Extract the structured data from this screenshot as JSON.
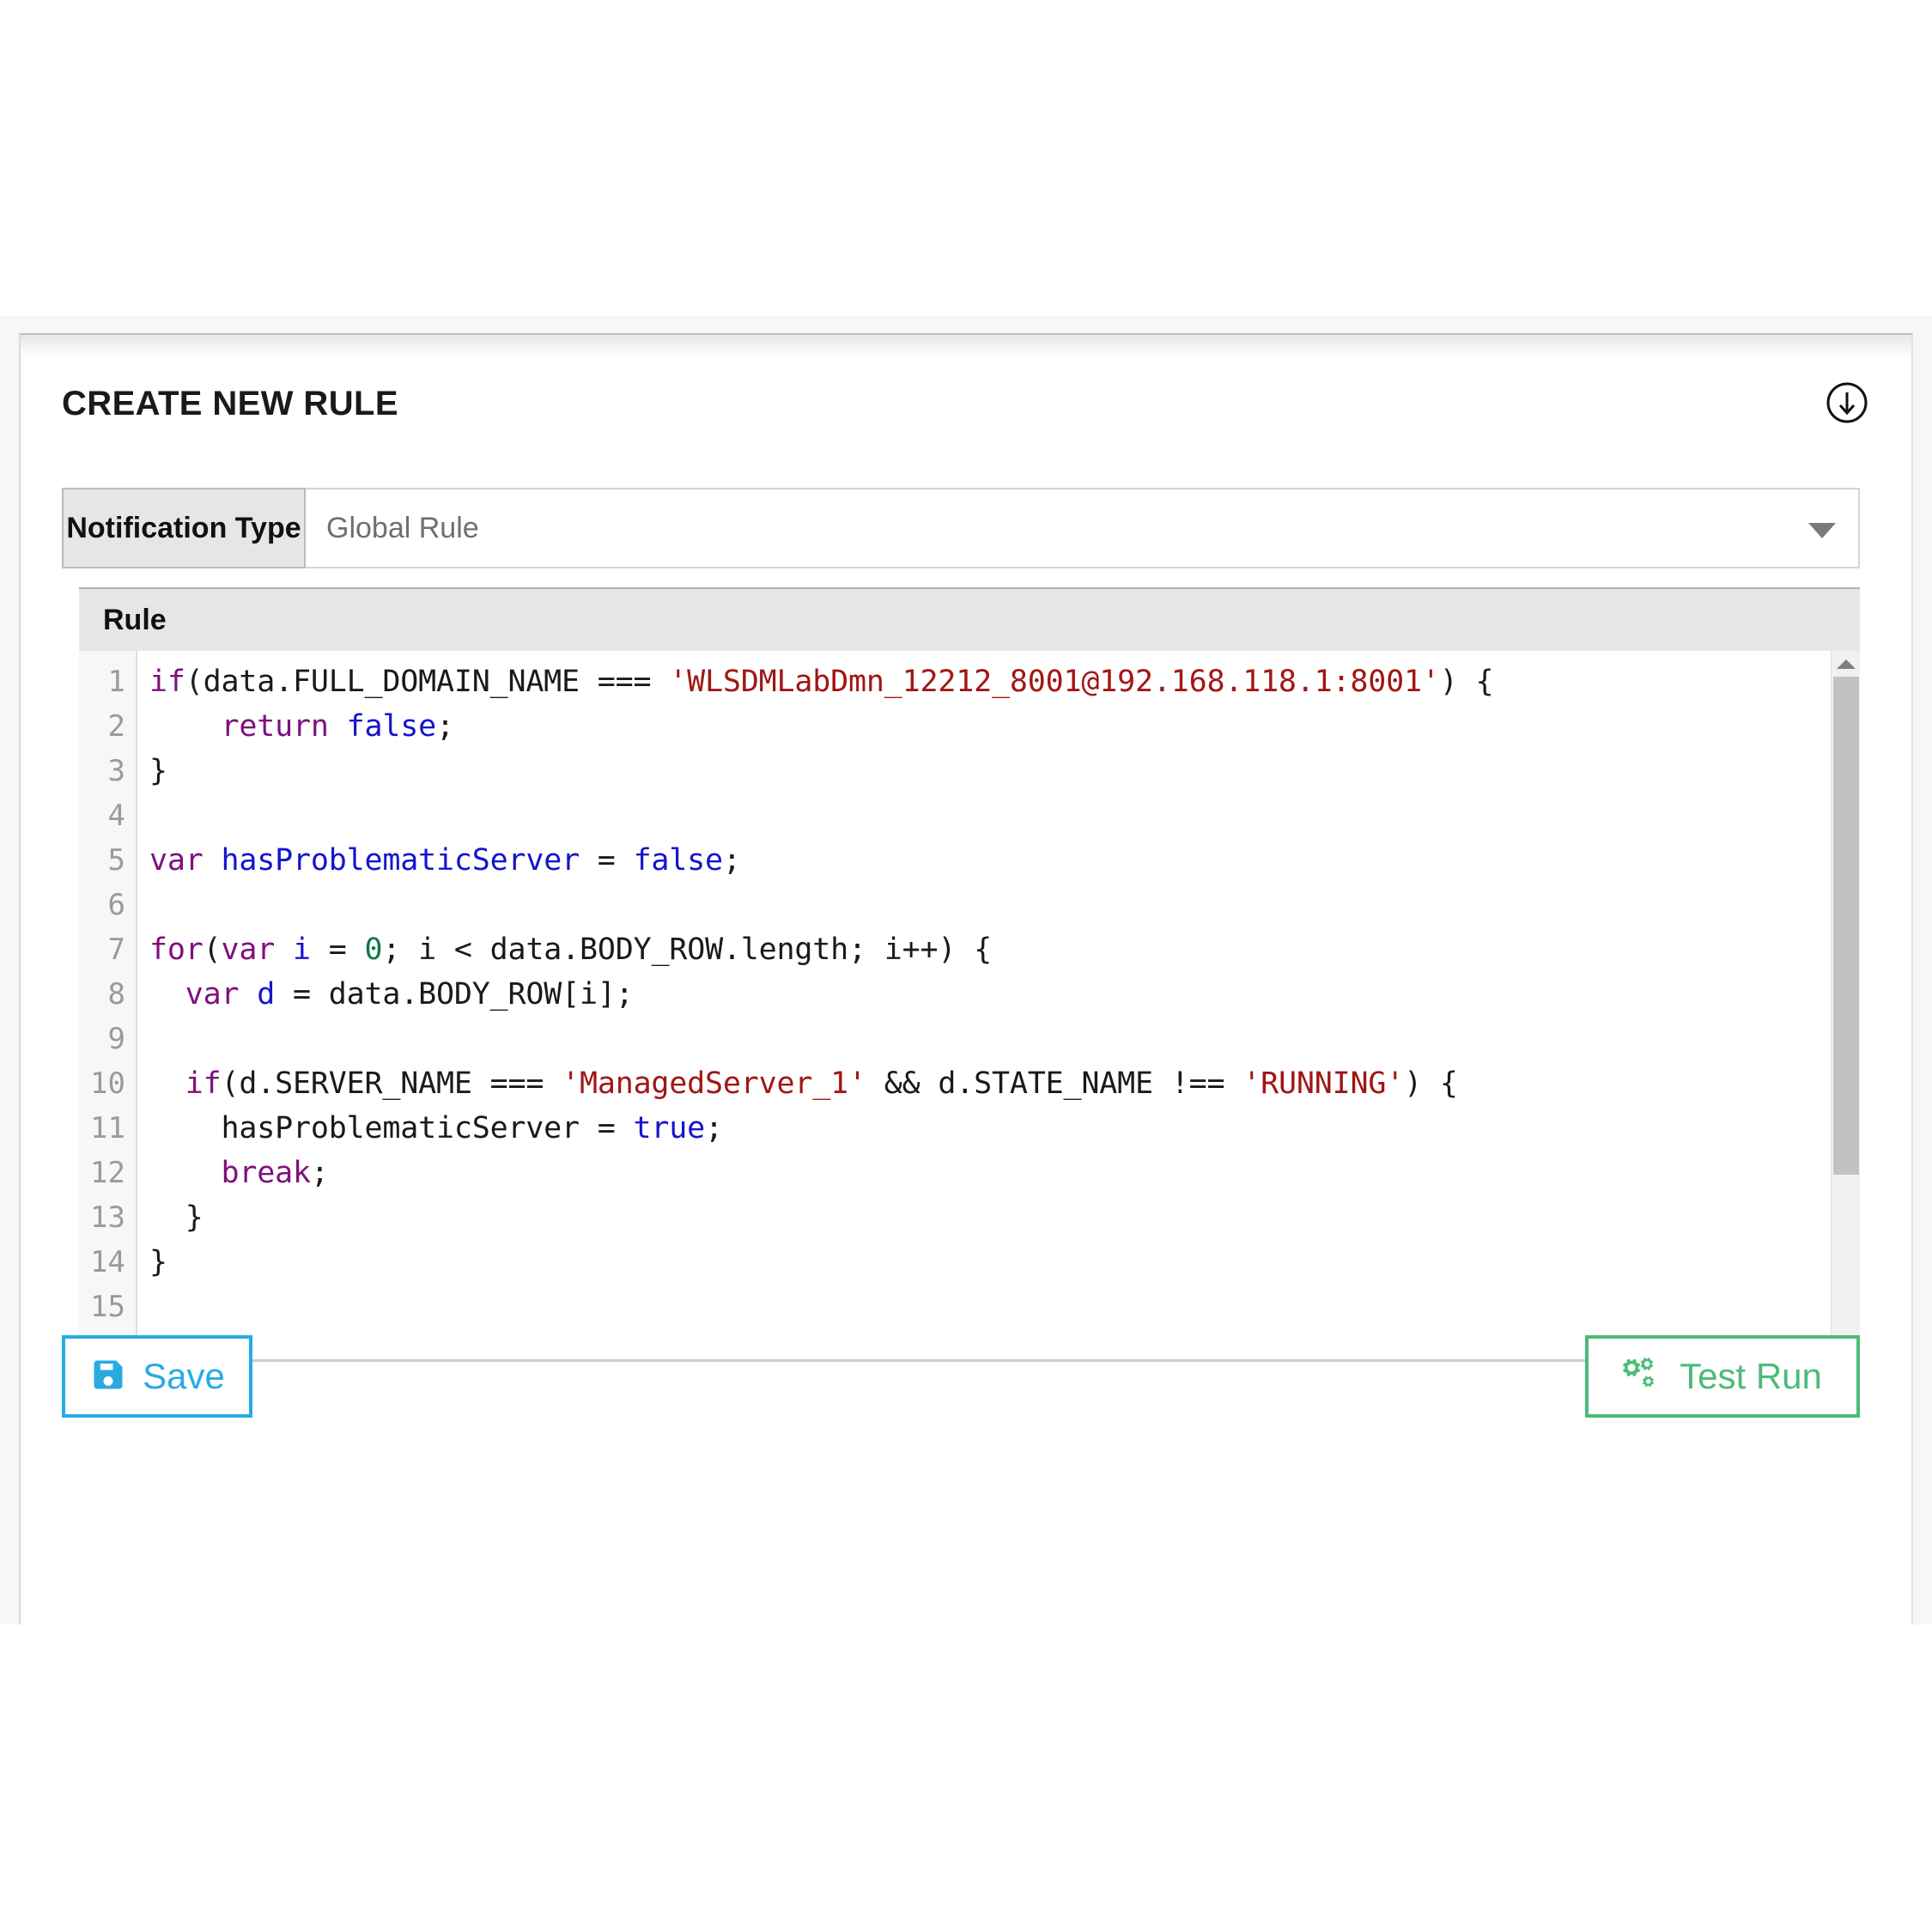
{
  "panel": {
    "title": "CREATE NEW RULE",
    "collapse_icon": "circle-arrow-down-icon"
  },
  "notification_type": {
    "label": "Notification Type",
    "selected": "Global Rule",
    "caret_icon": "chevron-down-icon"
  },
  "rule_section": {
    "header": "Rule",
    "gutter_lines": [
      "1",
      "2",
      "3",
      "4",
      "5",
      "6",
      "7",
      "8",
      "9",
      "10",
      "11",
      "12",
      "13",
      "14",
      "15"
    ],
    "code_lines": [
      [
        {
          "t": "if",
          "c": "kw"
        },
        {
          "t": "(data.FULL_DOMAIN_NAME === ",
          "c": "pl"
        },
        {
          "t": "'WLSDMLabDmn_12212_8001@192.168.118.1:8001'",
          "c": "str"
        },
        {
          "t": ") {",
          "c": "pl"
        }
      ],
      [
        {
          "t": "    ",
          "c": "pl"
        },
        {
          "t": "return",
          "c": "kw"
        },
        {
          "t": " ",
          "c": "pl"
        },
        {
          "t": "false",
          "c": "var"
        },
        {
          "t": ";",
          "c": "pl"
        }
      ],
      [
        {
          "t": "}",
          "c": "pl"
        }
      ],
      [],
      [
        {
          "t": "var",
          "c": "kw"
        },
        {
          "t": " ",
          "c": "pl"
        },
        {
          "t": "hasProblematicServer",
          "c": "var"
        },
        {
          "t": " = ",
          "c": "pl"
        },
        {
          "t": "false",
          "c": "var"
        },
        {
          "t": ";",
          "c": "pl"
        }
      ],
      [],
      [
        {
          "t": "for",
          "c": "kw"
        },
        {
          "t": "(",
          "c": "pl"
        },
        {
          "t": "var",
          "c": "kw"
        },
        {
          "t": " ",
          "c": "pl"
        },
        {
          "t": "i",
          "c": "var"
        },
        {
          "t": " = ",
          "c": "pl"
        },
        {
          "t": "0",
          "c": "num"
        },
        {
          "t": "; i < data.BODY_ROW.length; i++) {",
          "c": "pl"
        }
      ],
      [
        {
          "t": "  ",
          "c": "pl"
        },
        {
          "t": "var",
          "c": "kw"
        },
        {
          "t": " ",
          "c": "pl"
        },
        {
          "t": "d",
          "c": "var"
        },
        {
          "t": " = data.BODY_ROW[i];",
          "c": "pl"
        }
      ],
      [],
      [
        {
          "t": "  ",
          "c": "pl"
        },
        {
          "t": "if",
          "c": "kw"
        },
        {
          "t": "(d.SERVER_NAME === ",
          "c": "pl"
        },
        {
          "t": "'ManagedServer_1'",
          "c": "str"
        },
        {
          "t": " && d.STATE_NAME !== ",
          "c": "pl"
        },
        {
          "t": "'RUNNING'",
          "c": "str"
        },
        {
          "t": ") {",
          "c": "pl"
        }
      ],
      [
        {
          "t": "    hasProblematicServer = ",
          "c": "pl"
        },
        {
          "t": "true",
          "c": "var"
        },
        {
          "t": ";",
          "c": "pl"
        }
      ],
      [
        {
          "t": "    ",
          "c": "pl"
        },
        {
          "t": "break",
          "c": "kw"
        },
        {
          "t": ";",
          "c": "pl"
        }
      ],
      [
        {
          "t": "  }",
          "c": "pl"
        }
      ],
      [
        {
          "t": "}",
          "c": "pl"
        }
      ],
      []
    ],
    "scrollbar": {
      "up_arrow_icon": "triangle-up-icon",
      "down_arrow_icon": "triangle-down-icon"
    }
  },
  "actions": {
    "save": {
      "label": "Save",
      "icon": "floppy-disk-save-icon",
      "color": "#29abe2"
    },
    "test_run": {
      "label": "Test Run",
      "icon": "cogs-icon",
      "color": "#4cbb78"
    }
  }
}
